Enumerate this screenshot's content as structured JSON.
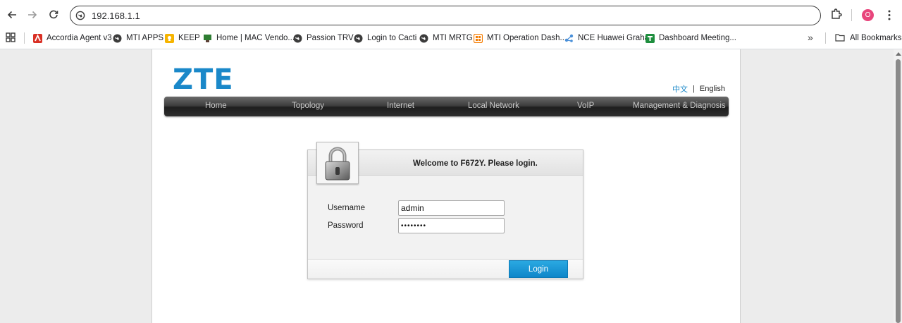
{
  "browser": {
    "url": "192.168.1.1",
    "profile_initial": "O",
    "bookmarks": [
      {
        "label": "Accordia Agent v3",
        "icon": "accordia-icon"
      },
      {
        "label": "MTI APPS",
        "icon": "globe-icon"
      },
      {
        "label": "KEEP",
        "icon": "keep-icon"
      },
      {
        "label": "Home | MAC Vendo...",
        "icon": "mac-vendor-icon"
      },
      {
        "label": "Passion TRV",
        "icon": "globe-icon"
      },
      {
        "label": "Login to Cacti",
        "icon": "globe-icon"
      },
      {
        "label": "MTI MRTG",
        "icon": "globe-icon"
      },
      {
        "label": "MTI Operation Dash...",
        "icon": "dashboard-icon"
      },
      {
        "label": "NCE Huawei Graha",
        "icon": "nce-icon"
      },
      {
        "label": "Dashboard Meeting...",
        "icon": "sheets-icon"
      }
    ],
    "overflow_label": "»",
    "all_bookmarks_label": "All Bookmarks"
  },
  "router": {
    "logo": "ZTE",
    "lang_cn": "中文",
    "lang_sep": "|",
    "lang_en": "English",
    "menu": [
      "Home",
      "Topology",
      "Internet",
      "Local Network",
      "VoIP",
      "Management & Diagnosis"
    ],
    "menu_color": "#c9c9c9",
    "accent": "#1a88c9"
  },
  "login": {
    "title": "Welcome to F672Y. Please login.",
    "username_label": "Username",
    "username_value": "admin",
    "password_label": "Password",
    "password_value": "••••••••",
    "button_label": "Login"
  }
}
